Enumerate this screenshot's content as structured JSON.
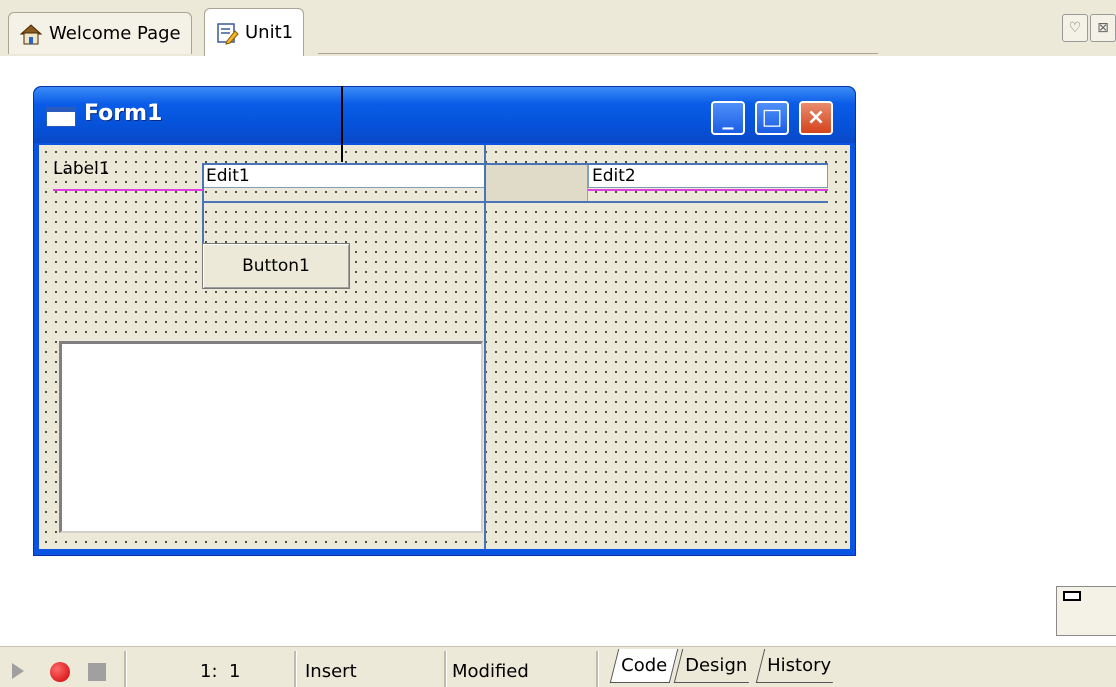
{
  "tabs": [
    {
      "label": "Welcome Page",
      "icon": "home-icon"
    },
    {
      "label": "Unit1",
      "icon": "unit-edit-icon",
      "active": true
    }
  ],
  "form": {
    "title": "Form1",
    "title_buttons": {
      "minimize": "_",
      "maximize": "□",
      "close": "×"
    },
    "label1": "Label1",
    "edit1": "Edit1",
    "edit2": "Edit2",
    "button1": "Button1"
  },
  "status": {
    "position": "1:  1",
    "mode": "Insert",
    "modified": "Modified"
  },
  "bottom_tabs": [
    {
      "label": "Code",
      "active": true
    },
    {
      "label": "Design"
    },
    {
      "label": "History"
    }
  ],
  "colors": {
    "titlebar": "#0a54e3",
    "designer_bg": "#ece9d8",
    "guide_pink": "#e040e0"
  }
}
